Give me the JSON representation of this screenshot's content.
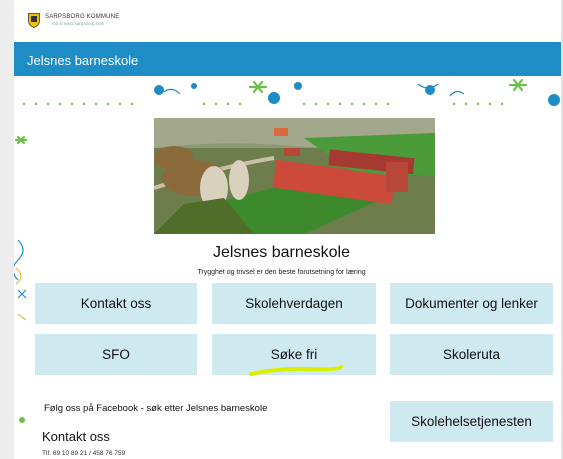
{
  "header": {
    "org_name": "SARPSBORG KOMMUNE",
    "org_sub": "Gå til www.sarpsborg.com"
  },
  "banner": {
    "title": "Jelsnes barneskole"
  },
  "main": {
    "school_name": "Jelsnes barneskole",
    "tagline": "Trygghet og trivsel er den beste forutsetning for læring",
    "tiles": [
      {
        "label": "Kontakt oss"
      },
      {
        "label": "Skolehverdagen"
      },
      {
        "label": "Dokumenter og lenker"
      },
      {
        "label": "SFO"
      },
      {
        "label": "Søke fri"
      },
      {
        "label": "Skoleruta"
      },
      {
        "label": "Skolehelsetjenesten"
      }
    ]
  },
  "footer": {
    "facebook_text": "Følg oss på Facebook - søk etter Jelsnes barneskole",
    "contact_heading": "Kontakt oss",
    "phone": "Tlf. 69 10 89 21 / 458 76 759"
  },
  "colors": {
    "banner": "#1e8dc5",
    "tile": "#cfe9f1",
    "highlight": "#d8f000",
    "accent_green": "#6cc04a"
  }
}
